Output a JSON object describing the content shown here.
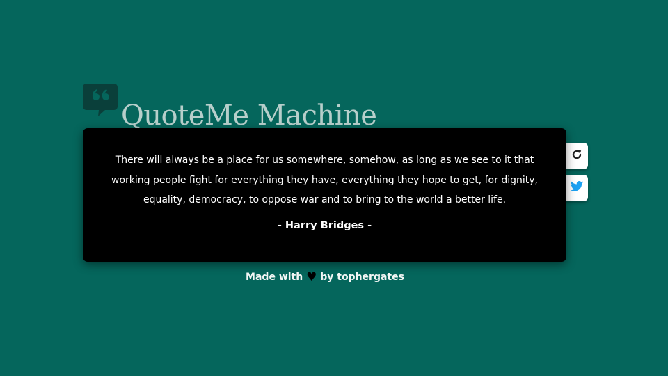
{
  "header": {
    "logo_icon": "quote-bubble-icon",
    "title": "QuoteMe Machine"
  },
  "actions": {
    "refresh_icon": "refresh-icon",
    "tweet_icon": "twitter-icon"
  },
  "quote": {
    "text": "There will always be a place for us somewhere, somehow, as long as we see to it that working people fight for everything they have, everything they hope to get, for dignity, equality, democracy, to oppose war and to bring to the world a better life.",
    "author": "- Harry Bridges -"
  },
  "footer": {
    "made_with": "Made with",
    "heart_icon": "heart-icon",
    "heart_glyph": "♥",
    "by": "by",
    "author_name": "tophergates"
  },
  "colors": {
    "background": "#05665c",
    "title": "#b7cfcb",
    "card": "#000000",
    "twitter": "#1da1f2"
  }
}
